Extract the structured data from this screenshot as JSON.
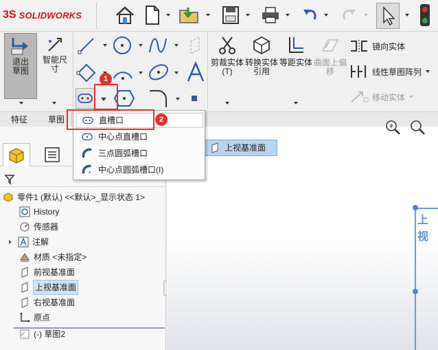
{
  "app": {
    "logo_ds": "3S",
    "logo_text": "SOLIDWORKS"
  },
  "toolbar": {
    "icons": [
      "home-icon",
      "new-doc-icon",
      "open-icon",
      "save-icon",
      "print-icon",
      "undo-icon",
      "redo-icon",
      "select-icon",
      "traffic-light-icon"
    ]
  },
  "command_manager": {
    "exit_sketch": "退出草图",
    "smart_dim": "智能尺寸",
    "trim": "剪裁实体(T)",
    "convert": "转换实体引用",
    "offset": "等距实体",
    "surface_offset": "曲面上偏移",
    "mirror": "镜向实体",
    "linear_pattern": "线性草图阵列",
    "move": "移动实体"
  },
  "tabs": {
    "features": "特征",
    "sketch": "草图"
  },
  "dropdown": {
    "items": [
      "直槽口",
      "中心点直槽口",
      "三点圆弧槽口",
      "中心点圆弧槽口(I)"
    ]
  },
  "badges": {
    "one": "1",
    "two": "2"
  },
  "tree": {
    "root": "零件1 (默认) <<默认>_显示状态 1>",
    "items": [
      "History",
      "传感器",
      "注解",
      "材质 <未指定>",
      "前视基准面",
      "上视基准面",
      "右视基准面",
      "原点",
      "(-) 草图2"
    ]
  },
  "canvas": {
    "tag": "上视基准面",
    "plane_label": "上视"
  },
  "colors": {
    "accent_red": "#e03030",
    "plane_blue": "#5c8fd6",
    "selection": "#cde3f7"
  }
}
